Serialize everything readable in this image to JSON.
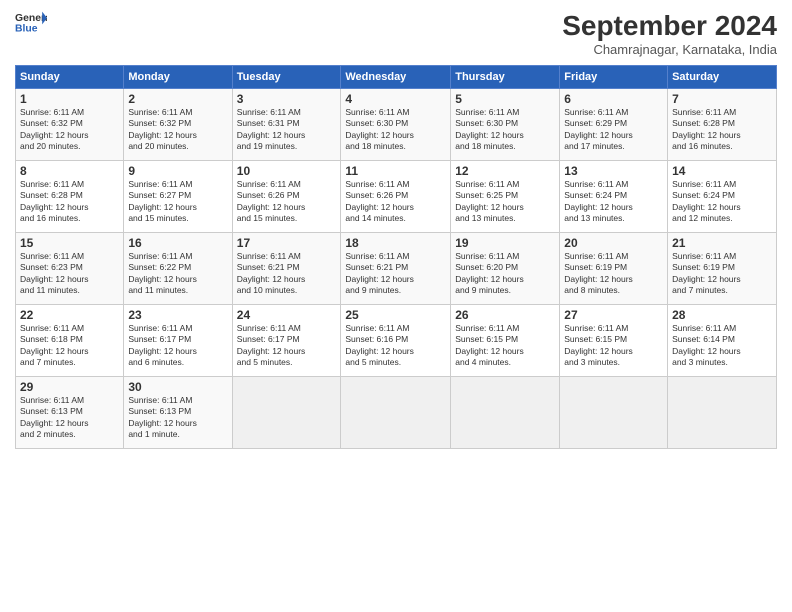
{
  "header": {
    "logo_line1": "General",
    "logo_line2": "Blue",
    "title": "September 2024",
    "subtitle": "Chamrajnagar, Karnataka, India"
  },
  "weekdays": [
    "Sunday",
    "Monday",
    "Tuesday",
    "Wednesday",
    "Thursday",
    "Friday",
    "Saturday"
  ],
  "weeks": [
    [
      {
        "day": "1",
        "info": "Sunrise: 6:11 AM\nSunset: 6:32 PM\nDaylight: 12 hours\nand 20 minutes."
      },
      {
        "day": "2",
        "info": "Sunrise: 6:11 AM\nSunset: 6:32 PM\nDaylight: 12 hours\nand 20 minutes."
      },
      {
        "day": "3",
        "info": "Sunrise: 6:11 AM\nSunset: 6:31 PM\nDaylight: 12 hours\nand 19 minutes."
      },
      {
        "day": "4",
        "info": "Sunrise: 6:11 AM\nSunset: 6:30 PM\nDaylight: 12 hours\nand 18 minutes."
      },
      {
        "day": "5",
        "info": "Sunrise: 6:11 AM\nSunset: 6:30 PM\nDaylight: 12 hours\nand 18 minutes."
      },
      {
        "day": "6",
        "info": "Sunrise: 6:11 AM\nSunset: 6:29 PM\nDaylight: 12 hours\nand 17 minutes."
      },
      {
        "day": "7",
        "info": "Sunrise: 6:11 AM\nSunset: 6:28 PM\nDaylight: 12 hours\nand 16 minutes."
      }
    ],
    [
      {
        "day": "8",
        "info": "Sunrise: 6:11 AM\nSunset: 6:28 PM\nDaylight: 12 hours\nand 16 minutes."
      },
      {
        "day": "9",
        "info": "Sunrise: 6:11 AM\nSunset: 6:27 PM\nDaylight: 12 hours\nand 15 minutes."
      },
      {
        "day": "10",
        "info": "Sunrise: 6:11 AM\nSunset: 6:26 PM\nDaylight: 12 hours\nand 15 minutes."
      },
      {
        "day": "11",
        "info": "Sunrise: 6:11 AM\nSunset: 6:26 PM\nDaylight: 12 hours\nand 14 minutes."
      },
      {
        "day": "12",
        "info": "Sunrise: 6:11 AM\nSunset: 6:25 PM\nDaylight: 12 hours\nand 13 minutes."
      },
      {
        "day": "13",
        "info": "Sunrise: 6:11 AM\nSunset: 6:24 PM\nDaylight: 12 hours\nand 13 minutes."
      },
      {
        "day": "14",
        "info": "Sunrise: 6:11 AM\nSunset: 6:24 PM\nDaylight: 12 hours\nand 12 minutes."
      }
    ],
    [
      {
        "day": "15",
        "info": "Sunrise: 6:11 AM\nSunset: 6:23 PM\nDaylight: 12 hours\nand 11 minutes."
      },
      {
        "day": "16",
        "info": "Sunrise: 6:11 AM\nSunset: 6:22 PM\nDaylight: 12 hours\nand 11 minutes."
      },
      {
        "day": "17",
        "info": "Sunrise: 6:11 AM\nSunset: 6:21 PM\nDaylight: 12 hours\nand 10 minutes."
      },
      {
        "day": "18",
        "info": "Sunrise: 6:11 AM\nSunset: 6:21 PM\nDaylight: 12 hours\nand 9 minutes."
      },
      {
        "day": "19",
        "info": "Sunrise: 6:11 AM\nSunset: 6:20 PM\nDaylight: 12 hours\nand 9 minutes."
      },
      {
        "day": "20",
        "info": "Sunrise: 6:11 AM\nSunset: 6:19 PM\nDaylight: 12 hours\nand 8 minutes."
      },
      {
        "day": "21",
        "info": "Sunrise: 6:11 AM\nSunset: 6:19 PM\nDaylight: 12 hours\nand 7 minutes."
      }
    ],
    [
      {
        "day": "22",
        "info": "Sunrise: 6:11 AM\nSunset: 6:18 PM\nDaylight: 12 hours\nand 7 minutes."
      },
      {
        "day": "23",
        "info": "Sunrise: 6:11 AM\nSunset: 6:17 PM\nDaylight: 12 hours\nand 6 minutes."
      },
      {
        "day": "24",
        "info": "Sunrise: 6:11 AM\nSunset: 6:17 PM\nDaylight: 12 hours\nand 5 minutes."
      },
      {
        "day": "25",
        "info": "Sunrise: 6:11 AM\nSunset: 6:16 PM\nDaylight: 12 hours\nand 5 minutes."
      },
      {
        "day": "26",
        "info": "Sunrise: 6:11 AM\nSunset: 6:15 PM\nDaylight: 12 hours\nand 4 minutes."
      },
      {
        "day": "27",
        "info": "Sunrise: 6:11 AM\nSunset: 6:15 PM\nDaylight: 12 hours\nand 3 minutes."
      },
      {
        "day": "28",
        "info": "Sunrise: 6:11 AM\nSunset: 6:14 PM\nDaylight: 12 hours\nand 3 minutes."
      }
    ],
    [
      {
        "day": "29",
        "info": "Sunrise: 6:11 AM\nSunset: 6:13 PM\nDaylight: 12 hours\nand 2 minutes."
      },
      {
        "day": "30",
        "info": "Sunrise: 6:11 AM\nSunset: 6:13 PM\nDaylight: 12 hours\nand 1 minute."
      },
      null,
      null,
      null,
      null,
      null
    ]
  ]
}
